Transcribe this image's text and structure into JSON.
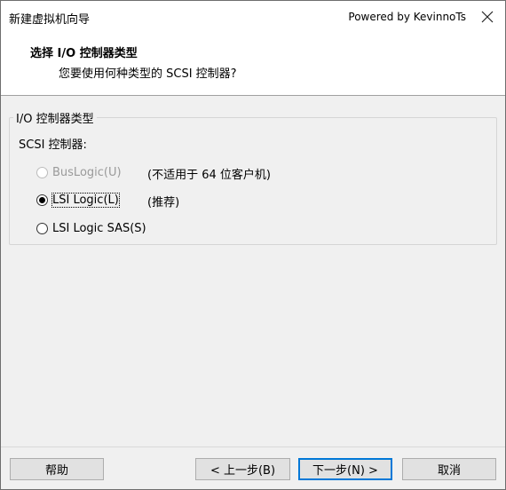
{
  "window": {
    "title": "新建虚拟机向导",
    "powered_by": "Powered by KevinnoTs"
  },
  "header": {
    "title": "选择 I/O 控制器类型",
    "subtitle": "您要使用何种类型的 SCSI 控制器?"
  },
  "group": {
    "legend": "I/O 控制器类型",
    "scsi_label": "SCSI 控制器:",
    "options": [
      {
        "label": "BusLogic(U)",
        "note": "(不适用于 64 位客户机)",
        "checked": false,
        "disabled": true
      },
      {
        "label": "LSI Logic(L)",
        "note": "(推荐)",
        "checked": true,
        "disabled": false
      },
      {
        "label": "LSI Logic SAS(S)",
        "note": "",
        "checked": false,
        "disabled": false
      }
    ]
  },
  "buttons": {
    "help": "帮助",
    "back": "< 上一步(B)",
    "next": "下一步(N) >",
    "cancel": "取消"
  },
  "icons": {
    "close": "close-icon"
  }
}
